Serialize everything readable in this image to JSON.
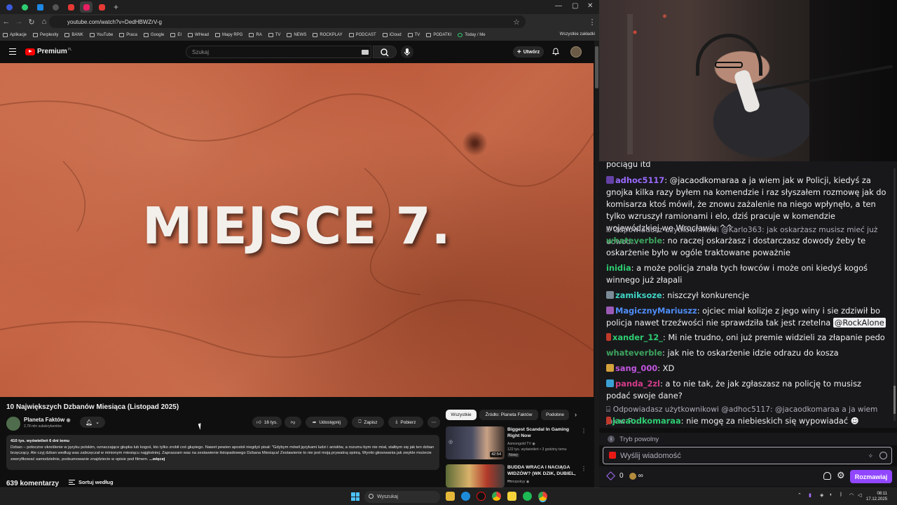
{
  "browser": {
    "url": "youtube.com/watch?v=DedHBWZrV-g",
    "tab_colors": [
      "#3b5bdb",
      "#2ecc71",
      "#1e88e5",
      "#555555",
      "#e53935",
      "#e91e63",
      "#e53935"
    ],
    "bookmarks": [
      "Aplikacje",
      "Perplexity",
      "BANK",
      "YouTube",
      "Praca",
      "Google",
      "EI",
      "WHead",
      "Mapy RPG",
      "RA",
      "TV",
      "NEWS",
      "ROCKPLAY",
      "PODCAST",
      "iCloud",
      "TV",
      "PODATKI",
      "Today / Me"
    ],
    "bookmarks_more": "Wszystkie zakładki"
  },
  "youtube": {
    "logo": "Premium",
    "logo_sup": "PL",
    "search_placeholder": "Szukaj",
    "create_label": "Utwórz",
    "video_overlay_text": "MIEJSCE 7.",
    "video_title": "10 Największych Dzbanów Miesiąca (Listopad 2025)",
    "channel_name": "Planeta Faktów",
    "channel_subs": "2,78 mln subskrybentów",
    "likes": "16 tys.",
    "share_label": "Udostępnij",
    "save_label": "Zapisz",
    "download_label": "Pobierz",
    "desc_stats": "410 tys. wyświetleń  6 dni temu",
    "desc_text": "Dzban – potoczne określenie w języku polskim, oznaczające głupka lub kogoś, kto tylko zrobił coś głupiego. Nawet pewien apostoł niegdyś pisał: \"Gdybym mówił językami ludzi i aniołów, a rozumu bym nie miał, stałbym się jak ten dzban brzęczący. Ale czyj dzban według was zabrzęczał w minionym miesiącu najgłośniej. Zapraszam was na zestawienie listopadowego Dzbana Miesiąca! Zestawienie to nie jest moją prywatną opinią. Wyniki głosowania jak zwykle możecie zweryfikować samodzielnie, podsumowanie znajdziecie w opisie pod filmem.",
    "desc_more": "...więcej",
    "comments_count": "639 komentarzy",
    "sort_label": "Sortuj według",
    "chips": [
      "Wszystkie",
      "Źródło: Planeta Faktów",
      "Podobne"
    ],
    "recommendations": [
      {
        "title": "Biggest Scandal In Gaming Right Now",
        "channel": "Asmongold TV",
        "meta": "122 tys. wyświetleń • 3 godziny temu",
        "badge": "Nowy",
        "duration": "42:54"
      },
      {
        "title": "BUDDA WRACA I NACIĄGA WIDZÓW? (WK DZIK, DUBIEL, ...",
        "channel": "Konopskyy",
        "meta": "",
        "badge": "",
        "duration": ""
      }
    ]
  },
  "chat": {
    "top_fragment": "pociągu itd",
    "messages": [
      {
        "user": "adhoc5117",
        "color": "#9b6bff",
        "text": ": @jacaodkomaraa a ja wiem jak w Policji, kiedyś za gnojka kilka razy byłem na komendzie i raz słyszałem rozmowę jak do komisarza ktoś mówił, że znowu zażalenie na niego wpłynęło, a ten tylko wzruszył ramionami i elo, dziś pracuje w komendzie wojewódzkiej we Wrocławiu ^^"
      },
      {
        "reply": "Odpowiadasz użytkownikowi @Karlo363: jak oskarżasz musisz mieć już dowod..."
      },
      {
        "user": "whateverble",
        "color": "#3da35d",
        "text": ": no raczej oskarżasz i dostarczasz dowody żeby te oskarżenie było w ogóle traktowane poważnie"
      },
      {
        "user": "inidia",
        "color": "#2ecc71",
        "text": ": a może policja znała tych łowców i może oni kiedyś kogoś winnego już złapali"
      },
      {
        "user": "zamiksoze",
        "color": "#3fd4c5",
        "text": ": niszczył konkurencje"
      },
      {
        "user": "MagicznyMariuszz",
        "color": "#4f8df7",
        "text": ": ojciec miał kolizje z jego winy i sie zdziwił bo policja nawet trzeźwości nie sprawdziła tak jest rzetelna",
        "mention": "@RockAlone"
      },
      {
        "user": "xander_12_",
        "color": "#2ecc71",
        "text": ": Mi nie trudno, oni już premie widzieli za złapanie pedo"
      },
      {
        "user": "whateverble",
        "color": "#3da35d",
        "text": ": jak nie to oskarżenie idzie odrazu do kosza"
      },
      {
        "user": "sang_000",
        "color": "#c455e0",
        "text": ": XD"
      },
      {
        "user": "panda_2zl",
        "color": "#d43b8a",
        "text": ": a to nie tak, że jak zgłaszasz na policję to musisz podać swoje dane?"
      },
      {
        "reply": "Odpowiadasz użytkownikowi @adhoc5117: @jacaodkomaraa a ja wiem jak w P..."
      },
      {
        "user": "jacaodkomaraa",
        "color": "#2ecc71",
        "text": ": nie mogę za niebieskich się wypowiadać"
      }
    ],
    "slow_mode": "Tryb powolny",
    "input_placeholder": "Wyślij wiadomość",
    "points": "0",
    "send_label": "Rozmawiaj"
  },
  "taskbar": {
    "search_placeholder": "Wyszukaj",
    "time": "08:11",
    "date": "17.12.2025"
  }
}
